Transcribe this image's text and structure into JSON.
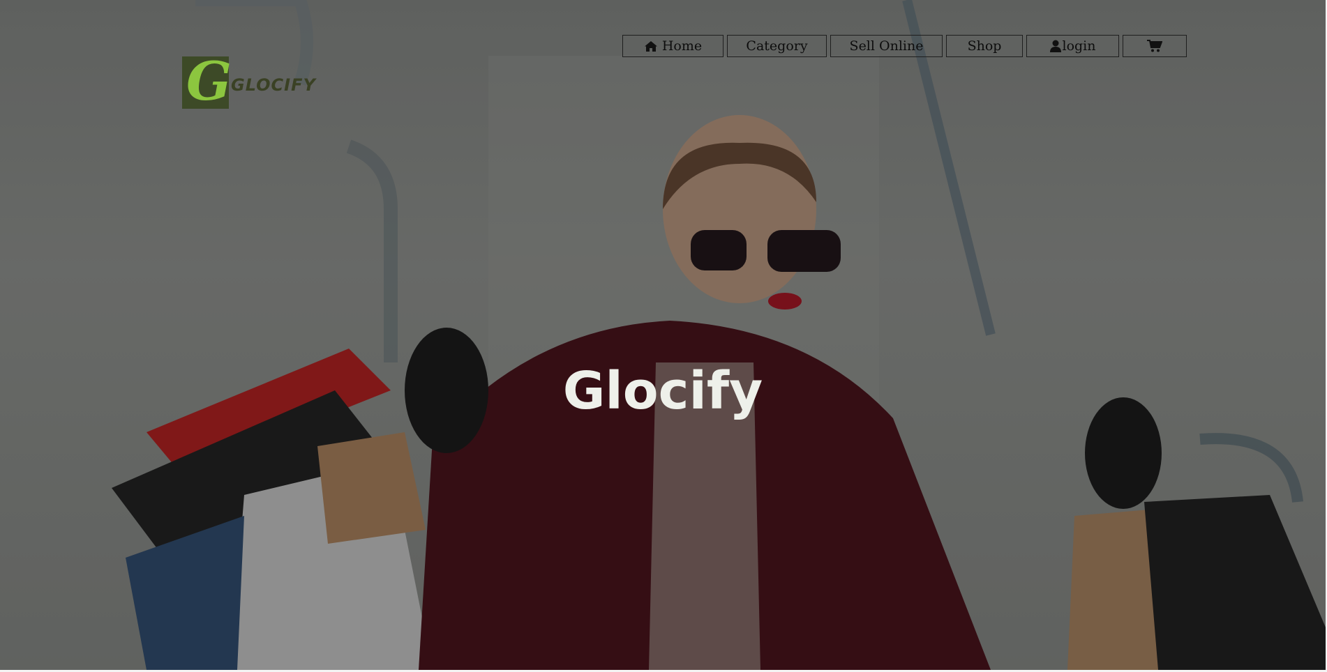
{
  "brand": {
    "logo_letter": "G",
    "logo_text": "GLOCIFY",
    "logo_color": "#8cc63f",
    "logo_bg": "#3d4a27"
  },
  "nav": {
    "home": {
      "label": "Home",
      "icon": "home-icon"
    },
    "category": {
      "label": "Category"
    },
    "sell_online": {
      "label": "Sell Online"
    },
    "shop": {
      "label": "Shop"
    },
    "login": {
      "label": "login",
      "icon": "user-icon"
    },
    "cart": {
      "icon": "shopping-cart-icon"
    }
  },
  "hero": {
    "title": "Glocify",
    "image": "woman-with-shopping-bags"
  }
}
